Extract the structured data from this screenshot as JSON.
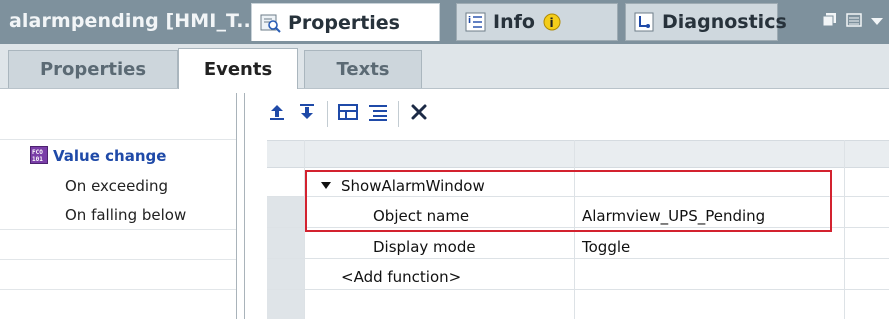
{
  "titlebar": {
    "object_title": "alarmpending [HMI_T...",
    "tabs": [
      {
        "label": "Properties",
        "icon": "properties-magnifier-icon"
      },
      {
        "label": "Info",
        "icon": "info-icon",
        "badge_icon": "info-badge-icon"
      },
      {
        "label": "Diagnostics",
        "icon": "diagnostics-icon"
      }
    ],
    "window_buttons": [
      "restore-icon",
      "menu-icon",
      "dropdown-arrow-icon"
    ]
  },
  "subtabs": [
    {
      "label": "Properties",
      "active": false
    },
    {
      "label": "Events",
      "active": true
    },
    {
      "label": "Texts",
      "active": false
    }
  ],
  "events": {
    "items": [
      {
        "label": "Value change",
        "selected": true,
        "icon": "value-change-icon"
      },
      {
        "label": "On exceeding",
        "selected": false
      },
      {
        "label": "On falling below",
        "selected": false
      }
    ]
  },
  "toolbar": {
    "buttons": [
      "move-up-icon",
      "move-down-icon",
      "expand-all-icon",
      "collapse-all-icon",
      "delete-icon"
    ]
  },
  "function_list": {
    "rows": [
      {
        "name": "ShowAlarmWindow",
        "value": "",
        "expanded": true
      },
      {
        "name": "Object name",
        "value": "Alarmview_UPS_Pending"
      },
      {
        "name": "Display mode",
        "value": "Toggle"
      },
      {
        "name": "<Add function>",
        "value": ""
      }
    ]
  },
  "colors": {
    "titlebar": "#7e919d",
    "highlight": "#d3222f",
    "selected_event": "#1f4aa8"
  }
}
